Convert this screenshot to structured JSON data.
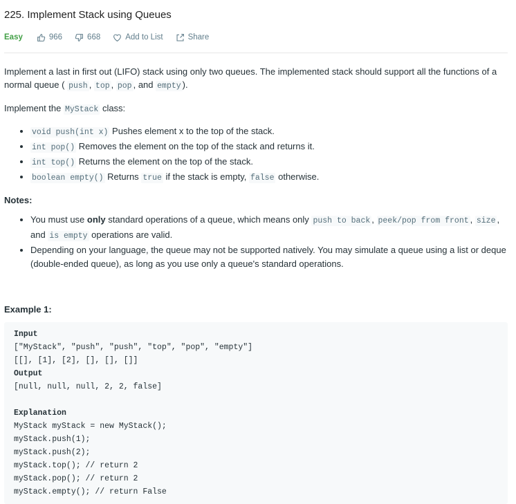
{
  "problem": {
    "title": "225. Implement Stack using Queues",
    "difficulty": "Easy",
    "likes": "966",
    "dislikes": "668",
    "add_to_list": "Add to List",
    "share": "Share"
  },
  "description": {
    "p1_text": "Implement a last in first out (LIFO) stack using only two queues. The implemented stack should support all the functions of a normal queue (",
    "p1_code1": "push",
    "p1_code2": "top",
    "p1_code3": "pop",
    "p1_and": ", and",
    "p1_code4": "empty",
    "p1_end": ").",
    "p2_text": "Implement the",
    "p2_code": "MyStack",
    "p2_end": "class:",
    "methods": [
      {
        "code": "void push(int x)",
        "text": "Pushes element x to the top of the stack."
      },
      {
        "code": "int pop()",
        "text": "Removes the element on the top of the stack and returns it."
      },
      {
        "code": "int top()",
        "text": "Returns the element on the top of the stack."
      },
      {
        "code": "boolean empty()",
        "text_before": "Returns",
        "code_true": "true",
        "text_mid": "if the stack is empty,",
        "code_false": "false",
        "text_after": "otherwise."
      }
    ]
  },
  "notes": {
    "heading": "Notes:",
    "n1_a": "You must use",
    "n1_bold": "only",
    "n1_b": "standard operations of a queue, which means only",
    "n1_c1": "push to back",
    "n1_c2": "peek/pop from front",
    "n1_c3": "size",
    "n1_and": ", and",
    "n1_c4": "is empty",
    "n1_end": "operations are valid.",
    "n2": "Depending on your language, the queue may not be supported natively. You may simulate a queue using a list or deque (double-ended queue), as long as you use only a queue's standard operations."
  },
  "example": {
    "heading": "Example 1:",
    "input_label": "Input",
    "input_line1": "[\"MyStack\", \"push\", \"push\", \"top\", \"pop\", \"empty\"]",
    "input_line2": "[[], [1], [2], [], [], []]",
    "output_label": "Output",
    "output_line": "[null, null, null, 2, 2, false]",
    "explanation_label": "Explanation",
    "explanation_lines": [
      "MyStack myStack = new MyStack();",
      "myStack.push(1);",
      "myStack.push(2);",
      "myStack.top(); // return 2",
      "myStack.pop(); // return 2",
      "myStack.empty(); // return False"
    ]
  }
}
